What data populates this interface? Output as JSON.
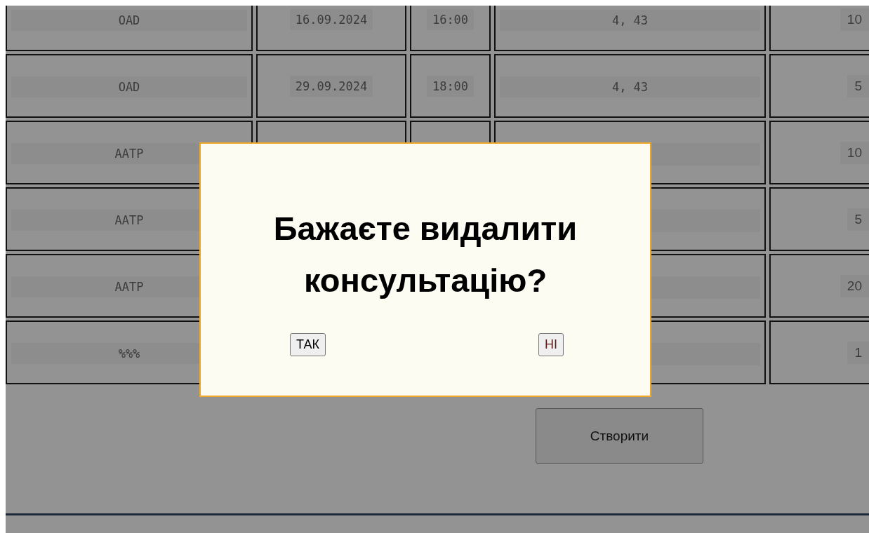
{
  "table": {
    "rows": [
      {
        "column_1": "OAD",
        "column_2": "16.09.2024",
        "column_3": "16:00",
        "column_4": "4, 43",
        "column_5": "10"
      },
      {
        "column_1": "OAD",
        "column_2": "29.09.2024",
        "column_3": "18:00",
        "column_4": "4, 43",
        "column_5": "5"
      },
      {
        "column_1": "AATP",
        "column_5": "10"
      },
      {
        "column_1": "AATP",
        "column_5": "5"
      },
      {
        "column_1": "AATP",
        "column_5": "20"
      },
      {
        "column_1": "%%%",
        "column_5": "1"
      }
    ]
  },
  "create_button": "Створити",
  "dialog": {
    "message": "Бажаєте видалити консультацію?",
    "buttons": [
      {
        "label": "ТАК"
      },
      {
        "label": "НІ"
      }
    ]
  }
}
